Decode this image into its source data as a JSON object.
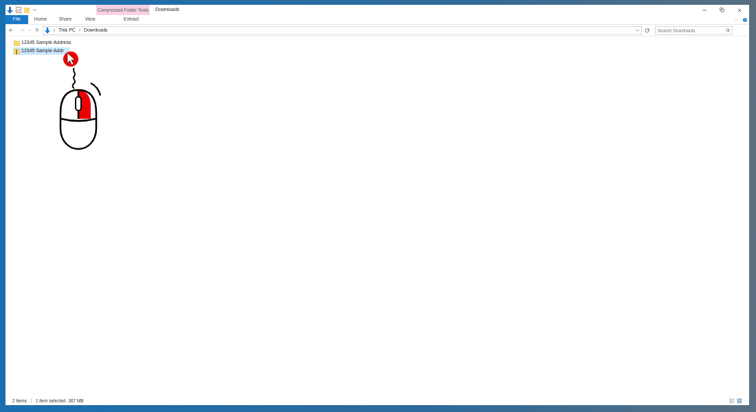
{
  "window": {
    "title": "Downloads",
    "context_tab_group": "Compressed Folder Tools"
  },
  "ribbon_tabs": [
    {
      "label": "File",
      "kind": "file"
    },
    {
      "label": "Home",
      "kind": "tab"
    },
    {
      "label": "Share",
      "kind": "tab"
    },
    {
      "label": "View",
      "kind": "tab"
    },
    {
      "label": "Extract",
      "kind": "context"
    }
  ],
  "address_bar": {
    "path": [
      "This PC",
      "Downloads"
    ]
  },
  "search": {
    "placeholder": "Search Downloads"
  },
  "files": [
    {
      "name": "12345 Sample Address",
      "kind": "folder",
      "selected": false
    },
    {
      "name": "12345 Sample Addr",
      "kind": "zip",
      "selected": true
    }
  ],
  "status_bar": {
    "count": "2 items",
    "selection": "1 item selected  367 MB"
  }
}
